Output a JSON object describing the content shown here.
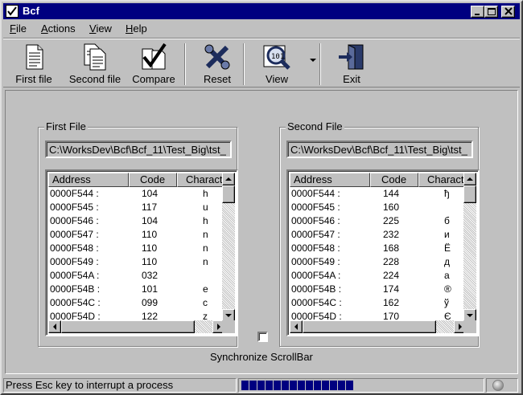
{
  "window": {
    "title": "Bcf"
  },
  "menu": [
    {
      "label": "File",
      "accel": "F",
      "rest": "ile"
    },
    {
      "label": "Actions",
      "accel": "A",
      "rest": "ctions"
    },
    {
      "label": "View",
      "accel": "V",
      "rest": "iew"
    },
    {
      "label": "Help",
      "accel": "H",
      "rest": "elp"
    }
  ],
  "toolbar": {
    "first_file": "First file",
    "second_file": "Second file",
    "compare": "Compare",
    "reset": "Reset",
    "view": "View",
    "exit": "Exit"
  },
  "first": {
    "group_title": "First File",
    "path": "C:\\WorksDev\\Bcf\\Bcf_11\\Test_Big\\tst_",
    "columns": [
      "Address",
      "Code",
      "Character"
    ],
    "rows": [
      [
        "0000F544 :",
        "104",
        "h"
      ],
      [
        "0000F545 :",
        "117",
        "u"
      ],
      [
        "0000F546 :",
        "104",
        "h"
      ],
      [
        "0000F547 :",
        "110",
        "n"
      ],
      [
        "0000F548 :",
        "110",
        "n"
      ],
      [
        "0000F549 :",
        "110",
        "n"
      ],
      [
        "0000F54A :",
        "032",
        ""
      ],
      [
        "0000F54B :",
        "101",
        "e"
      ],
      [
        "0000F54C :",
        "099",
        "c"
      ],
      [
        "0000F54D :",
        "122",
        "z"
      ]
    ]
  },
  "second": {
    "group_title": "Second File",
    "path": "C:\\WorksDev\\Bcf\\Bcf_11\\Test_Big\\tst_",
    "columns": [
      "Address",
      "Code",
      "Character"
    ],
    "rows": [
      [
        "0000F544 :",
        "144",
        "ђ"
      ],
      [
        "0000F545 :",
        "160",
        ""
      ],
      [
        "0000F546 :",
        "225",
        "б"
      ],
      [
        "0000F547 :",
        "232",
        "и"
      ],
      [
        "0000F548 :",
        "168",
        "Ё"
      ],
      [
        "0000F549 :",
        "228",
        "д"
      ],
      [
        "0000F54A :",
        "224",
        "а"
      ],
      [
        "0000F54B :",
        "174",
        "®"
      ],
      [
        "0000F54C :",
        "162",
        "ў"
      ],
      [
        "0000F54D :",
        "170",
        "Є"
      ]
    ]
  },
  "sync": {
    "label": "Synchronize ScrollBar",
    "checked": false
  },
  "status": {
    "message": "Press Esc key to interrupt a process",
    "progress_blocks": 14
  }
}
